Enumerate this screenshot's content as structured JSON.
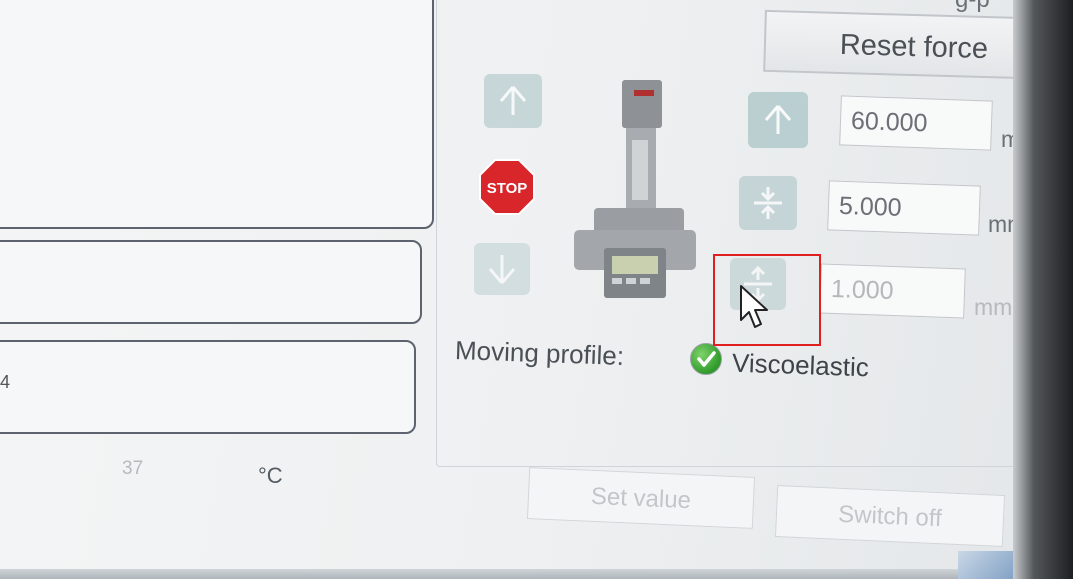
{
  "header": {
    "partial_label": "g-p"
  },
  "reset_force": {
    "label": "Reset force"
  },
  "controls": {
    "stop_label": "STOP",
    "travel_position": {
      "value": "60.000",
      "unit": "mm"
    },
    "compress_step": {
      "value": "5.000",
      "unit": "mm"
    },
    "expand_step": {
      "value": "1.000",
      "unit": "mm"
    }
  },
  "moving_profile": {
    "label": "Moving profile:",
    "value": "Viscoelastic"
  },
  "temperature": {
    "value": "37",
    "unit": "°C"
  },
  "left_panel": {
    "partial_text": "4"
  },
  "actions": {
    "set_value": "Set value",
    "switch_off": "Switch off"
  },
  "colors": {
    "stop_red": "#d8262a",
    "highlight_red": "#e02020",
    "check_green": "#3aa834"
  }
}
